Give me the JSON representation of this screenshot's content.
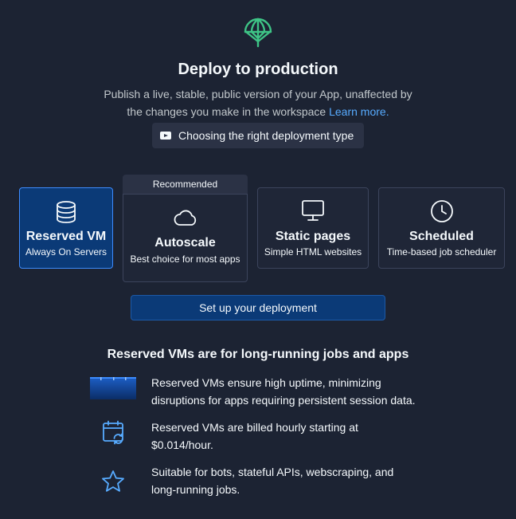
{
  "header": {
    "icon": "deploy-globe-icon",
    "title": "Deploy to production",
    "subtitle": "Publish a live, stable, public version of your App, unaffected by the changes you make in the workspace",
    "learn_more": "Learn more.",
    "video_button": "Choosing the right deployment type"
  },
  "deployment_types": [
    {
      "name": "Reserved VM",
      "description": "Always On Servers",
      "icon": "database-icon",
      "selected": true
    },
    {
      "name": "Autoscale",
      "description": "Best choice for most apps",
      "icon": "cloud-icon",
      "badge": "Recommended"
    },
    {
      "name": "Static pages",
      "description": "Simple HTML websites",
      "icon": "monitor-icon"
    },
    {
      "name": "Scheduled",
      "description": "Time-based job scheduler",
      "icon": "clock-icon"
    }
  ],
  "setup_button": "Set up your deployment",
  "info": {
    "title": "Reserved VMs are for long-running jobs and apps",
    "features": [
      {
        "icon": "uptime-bar-icon",
        "text": "Reserved VMs ensure high uptime, minimizing disruptions for apps requiring persistent session data."
      },
      {
        "icon": "calendar-refresh-icon",
        "text": "Reserved VMs are billed hourly starting at $0.014/hour."
      },
      {
        "icon": "star-icon",
        "text": "Suitable for bots, stateful APIs, webscraping, and long-running jobs."
      }
    ]
  },
  "colors": {
    "background": "#1c2333",
    "accent_green": "#3ec486",
    "accent_blue": "#57abff",
    "selected_card": "#0b3a77"
  }
}
